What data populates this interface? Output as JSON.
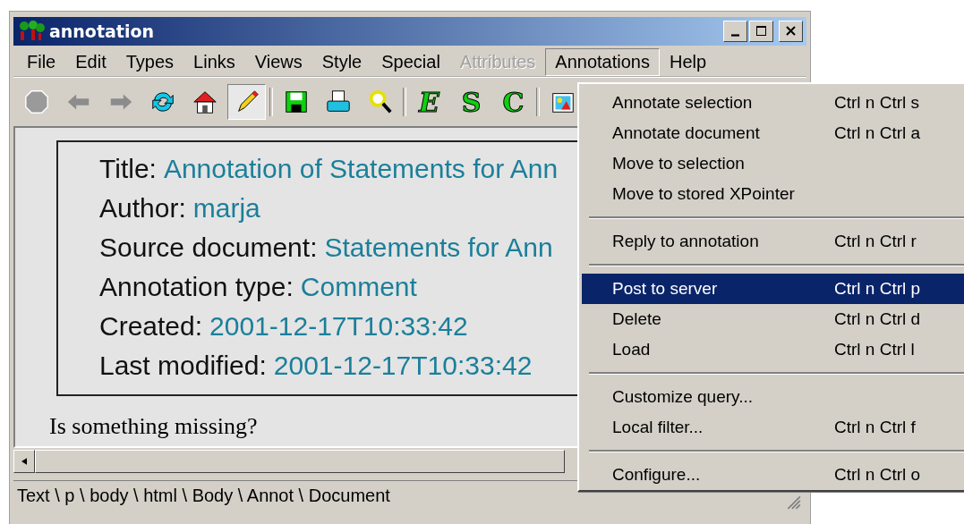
{
  "window": {
    "title": "annotation"
  },
  "menu_bar": [
    {
      "label": "File",
      "disabled": false,
      "selected": false
    },
    {
      "label": "Edit",
      "disabled": false,
      "selected": false
    },
    {
      "label": "Types",
      "disabled": false,
      "selected": false
    },
    {
      "label": "Links",
      "disabled": false,
      "selected": false
    },
    {
      "label": "Views",
      "disabled": false,
      "selected": false
    },
    {
      "label": "Style",
      "disabled": false,
      "selected": false
    },
    {
      "label": "Special",
      "disabled": false,
      "selected": false
    },
    {
      "label": "Attributes",
      "disabled": true,
      "selected": false
    },
    {
      "label": "Annotations",
      "disabled": false,
      "selected": true
    },
    {
      "label": "Help",
      "disabled": false,
      "selected": false
    }
  ],
  "toolbar": [
    {
      "kind": "stop",
      "pressed": false
    },
    {
      "kind": "back",
      "pressed": false
    },
    {
      "kind": "forward",
      "pressed": false
    },
    {
      "kind": "reload",
      "pressed": false
    },
    {
      "kind": "home",
      "pressed": false
    },
    {
      "kind": "pencil",
      "pressed": true
    },
    {
      "kind": "separator"
    },
    {
      "kind": "save",
      "pressed": false
    },
    {
      "kind": "print",
      "pressed": false
    },
    {
      "kind": "search",
      "pressed": false
    },
    {
      "kind": "separator"
    },
    {
      "kind": "letter",
      "label": "E",
      "italic": true,
      "pressed": false
    },
    {
      "kind": "letter",
      "label": "S",
      "italic": false,
      "pressed": false
    },
    {
      "kind": "letter",
      "label": "C",
      "italic": false,
      "pressed": false
    },
    {
      "kind": "separator"
    },
    {
      "kind": "picture",
      "pressed": false
    }
  ],
  "annotation": {
    "fields": [
      {
        "label": "Title:",
        "value": "Annotation of Statements for Ann"
      },
      {
        "label": "Author:",
        "value": "marja"
      },
      {
        "label": "Source document:",
        "value": "Statements for Ann"
      },
      {
        "label": "Annotation type:",
        "value": "Comment"
      },
      {
        "label": "Created:",
        "value": "2001-12-17T10:33:42"
      },
      {
        "label": "Last modified:",
        "value": "2001-12-17T10:33:42"
      }
    ],
    "body": "Is something missing?"
  },
  "status_bar": "Text \\ p \\ body \\ html \\ Body \\ Annot \\ Document",
  "annotations_menu": [
    {
      "kind": "item",
      "label": "Annotate selection",
      "shortcut": "Ctrl n Ctrl s",
      "selected": false
    },
    {
      "kind": "item",
      "label": "Annotate document",
      "shortcut": "Ctrl n Ctrl a",
      "selected": false
    },
    {
      "kind": "item",
      "label": "Move to selection",
      "selected": false
    },
    {
      "kind": "item",
      "label": "Move to stored XPointer",
      "selected": false
    },
    {
      "kind": "separator"
    },
    {
      "kind": "item",
      "label": "Reply to annotation",
      "shortcut": "Ctrl n Ctrl r",
      "selected": false
    },
    {
      "kind": "separator"
    },
    {
      "kind": "item",
      "label": "Post to server",
      "shortcut": "Ctrl n Ctrl p",
      "selected": true
    },
    {
      "kind": "item",
      "label": "Delete",
      "shortcut": "Ctrl n Ctrl d",
      "selected": false
    },
    {
      "kind": "item",
      "label": "Load",
      "shortcut": "Ctrl n Ctrl l",
      "selected": false
    },
    {
      "kind": "separator"
    },
    {
      "kind": "item",
      "label": "Customize query...",
      "selected": false
    },
    {
      "kind": "item",
      "label": "Local filter...",
      "shortcut": "Ctrl n Ctrl f",
      "selected": false
    },
    {
      "kind": "separator"
    },
    {
      "kind": "item",
      "label": "Configure...",
      "shortcut": "Ctrl n Ctrl o",
      "selected": false
    }
  ]
}
